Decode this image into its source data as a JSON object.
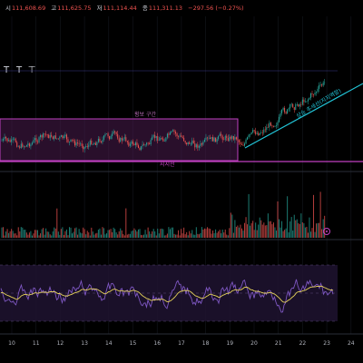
{
  "ohlc_bar": {
    "open_label": "시",
    "open_value": "111,608.69",
    "high_label": "고",
    "high_value": "111,625.75",
    "low_label": "저",
    "low_value": "111,114.44",
    "close_label": "종",
    "close_value": "111,311.13",
    "change_value": "−297.56 (−0.27%)"
  },
  "toolbar": {
    "tools": [
      {
        "name": "text-tool-1",
        "glyph": "T"
      },
      {
        "name": "text-tool-2",
        "glyph": "T"
      },
      {
        "name": "anchored-text-tool",
        "glyph": "⊤"
      }
    ]
  },
  "annotations": {
    "box_label": "횡보 구간",
    "support_label": "지지선",
    "trendline_label": "상승 추세선(지지역할)"
  },
  "x_axis": {
    "ticks": [
      "10",
      "11",
      "12",
      "13",
      "14",
      "15",
      "16",
      "17",
      "18",
      "19",
      "20",
      "21",
      "22",
      "23",
      "24"
    ]
  },
  "colors": {
    "up": "#26a69a",
    "down": "#ef5350",
    "box": "#c040c0",
    "trendline": "#22c5d8",
    "rsi": "#7e57c2",
    "rsi_ma": "#e6d35a"
  },
  "volume_marker_icon": "circle-icon"
}
